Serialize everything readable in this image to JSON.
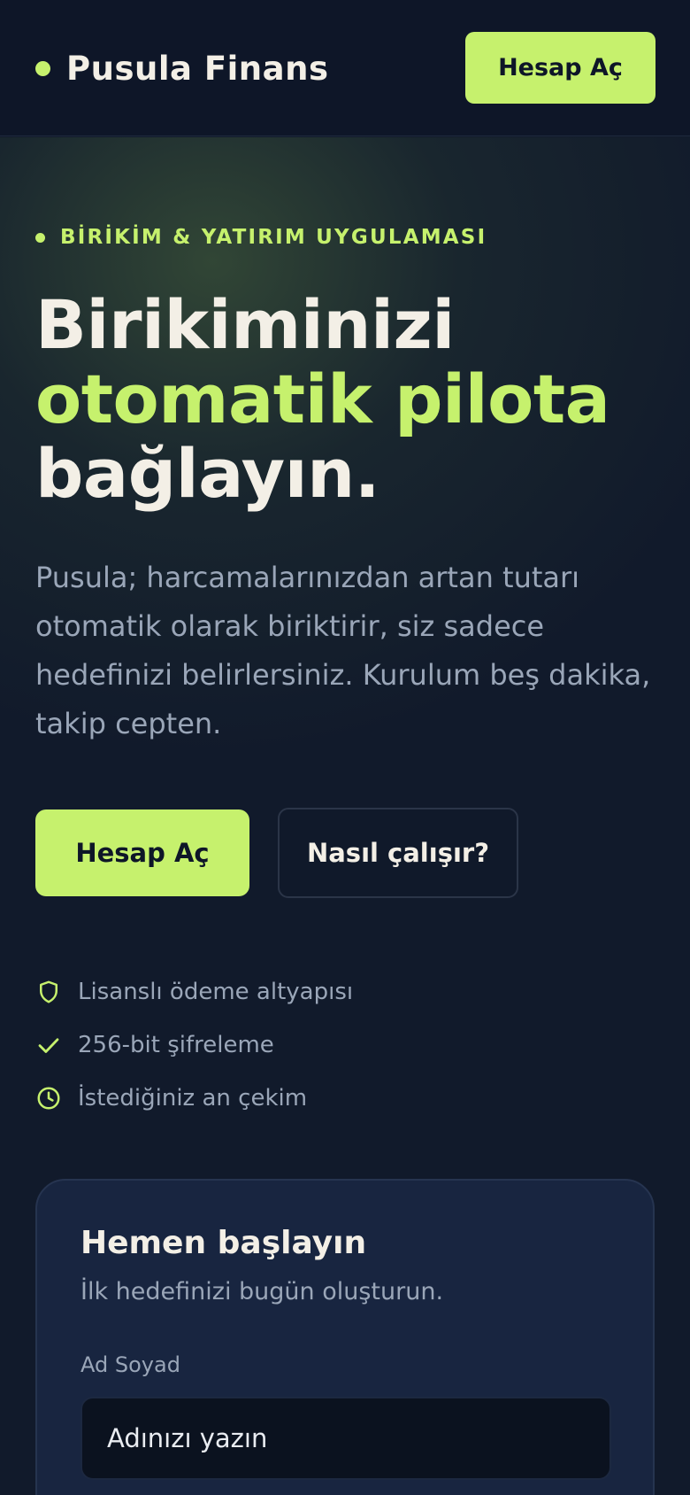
{
  "header": {
    "brand": "Pusula Finans",
    "cta_label": "Hesap Aç"
  },
  "hero": {
    "eyebrow": "BİRİKİM & YATIRIM UYGULAMASI",
    "headline": {
      "line1": "Birikiminizi",
      "line2": "otomatik pilota",
      "line3": "bağlayın."
    },
    "lead": "Pusula; harcamalarınızdan artan tutarı otomatik olarak biriktirir, siz sadece hedefinizi belirlersiniz. Kurulum beş dakika, takip cepten.",
    "primary_label": "Hesap Aç",
    "secondary_label": "Nasıl çalışır?"
  },
  "features": [
    {
      "icon": "shield-icon",
      "text": "Lisanslı ödeme altyapısı"
    },
    {
      "icon": "check-icon",
      "text": "256-bit şifreleme"
    },
    {
      "icon": "clock-icon",
      "text": "İstediğiniz an çekim"
    }
  ],
  "signup": {
    "title": "Hemen başlayın",
    "subtitle": "İlk hedefinizi bugün oluşturun.",
    "name_label": "Ad Soyad",
    "name_placeholder": "Adınızı yazın"
  },
  "colors": {
    "accent": "#c6f16d",
    "background": "#111a2b",
    "header": "#0e1628",
    "card": "#182540",
    "muted_text": "#9aa6b8"
  }
}
